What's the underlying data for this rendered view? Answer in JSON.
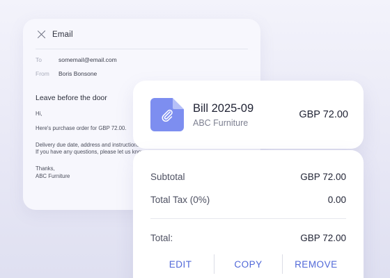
{
  "email": {
    "title": "Email",
    "to_label": "To",
    "to_value": "somemail@email.com",
    "from_label": "From",
    "from_value": "Boris Bonsone",
    "subject": "Leave before the door",
    "greeting": "Hi,",
    "paragraph1": "Here's purchase order for GBP 72.00.",
    "paragraph2_line1": "Delivery due date, address and instructions are attached.",
    "paragraph2_line2": "If you have any questions, please let us know.",
    "closing": "Thanks,",
    "signature": "ABC Furniture"
  },
  "bill": {
    "title": "Bill 2025-09",
    "vendor": "ABC Furniture",
    "amount": "GBP 72.00",
    "icon": "paperclip-document-icon"
  },
  "totals": {
    "subtotal_label": "Subtotal",
    "subtotal_value": "GBP 72.00",
    "tax_label": "Total Tax (0%)",
    "tax_value": "0.00",
    "total_label": "Total:",
    "total_value": "GBP 72.00"
  },
  "actions": {
    "edit": "EDIT",
    "copy": "COPY",
    "remove": "REMOVE"
  },
  "colors": {
    "accent": "#5068d8",
    "icon_bg": "#7d8ef0"
  }
}
